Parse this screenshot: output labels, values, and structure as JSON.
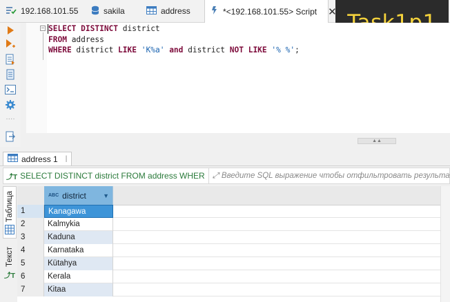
{
  "tabs": [
    {
      "label": "192.168.101.55",
      "icon": "connection-icon"
    },
    {
      "label": "sakila",
      "icon": "database-icon"
    },
    {
      "label": "address",
      "icon": "table-icon"
    },
    {
      "label": "*<192.168.101.55> Script",
      "icon": "sql-script-icon",
      "active": true
    }
  ],
  "overlay": {
    "label": "Task1p1"
  },
  "editor": {
    "lines": [
      [
        {
          "t": "SELECT DISTINCT",
          "c": "kw"
        },
        {
          "t": " district",
          "c": "plain"
        }
      ],
      [
        {
          "t": "FROM",
          "c": "kw"
        },
        {
          "t": " address",
          "c": "plain"
        }
      ],
      [
        {
          "t": "WHERE",
          "c": "kw"
        },
        {
          "t": " district ",
          "c": "plain"
        },
        {
          "t": "LIKE",
          "c": "kw"
        },
        {
          "t": " ",
          "c": "plain"
        },
        {
          "t": "'K%a'",
          "c": "str"
        },
        {
          "t": " ",
          "c": "plain"
        },
        {
          "t": "and",
          "c": "kw"
        },
        {
          "t": " district ",
          "c": "plain"
        },
        {
          "t": "NOT LIKE",
          "c": "kw"
        },
        {
          "t": " ",
          "c": "plain"
        },
        {
          "t": "'% %'",
          "c": "str"
        },
        {
          "t": ";",
          "c": "plain"
        }
      ]
    ]
  },
  "results": {
    "tab_label": "address 1",
    "query_text": "SELECT DISTINCT district FROM address WHER",
    "filter_placeholder": "Введите SQL выражение чтобы отфильтровать результат",
    "side_tabs": {
      "table": "Таблица",
      "text": "Текст"
    },
    "column": {
      "type_badge": "ABC",
      "name": "district"
    },
    "rows": [
      {
        "n": "1",
        "district": "Kanagawa",
        "selected": true
      },
      {
        "n": "2",
        "district": "Kalmykia"
      },
      {
        "n": "3",
        "district": "Kaduna"
      },
      {
        "n": "4",
        "district": "Karnataka"
      },
      {
        "n": "5",
        "district": "Kütahya"
      },
      {
        "n": "6",
        "district": "Kerala"
      },
      {
        "n": "7",
        "district": "Kitaa"
      }
    ]
  },
  "colors": {
    "keyword": "#7d0b3b",
    "string": "#1a63b0",
    "selection": "#3d94d8",
    "header_active": "#7fb6df",
    "overlay_text": "#f4d23c"
  }
}
